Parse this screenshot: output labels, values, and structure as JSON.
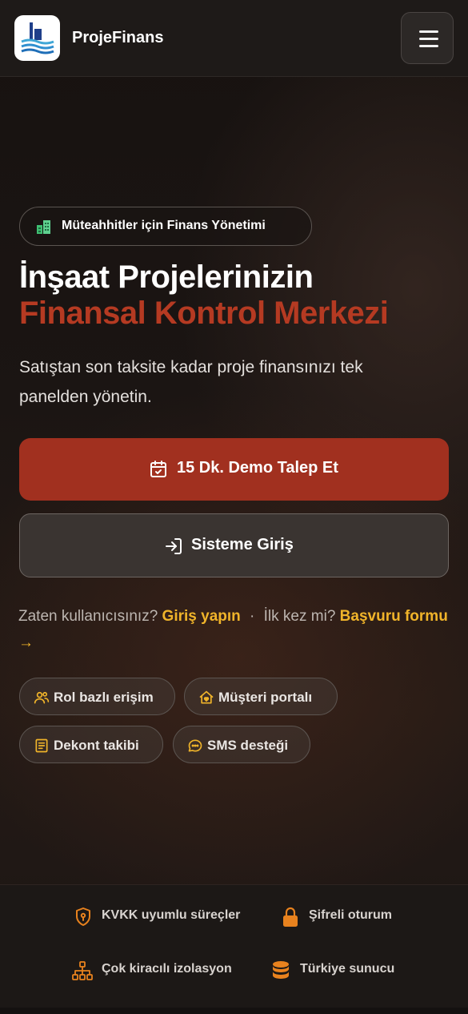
{
  "header": {
    "brand": "ProjeFinans",
    "menu_icon": "hamburger-menu-icon",
    "logo_icon": "building-logo-icon"
  },
  "hero": {
    "badge": "Müteahhitler için Finans Yönetimi",
    "badge_icon": "buildings-icon",
    "title_line1": "İnşaat Projelerinizin",
    "title_line2": "Finansal Kontrol Merkezi",
    "lead": "Satıştan son taksite kadar proje finansınızı tek panelden yönetin."
  },
  "actions": {
    "primary_label": "15 Dk. Demo Talep Et",
    "primary_icon": "calendar-check-icon",
    "secondary_label": "Sisteme Giriş",
    "secondary_icon": "login-icon"
  },
  "helper": {
    "existing_text": "Zaten kullanıcısınız?",
    "login_link": "Giriş yapın",
    "separator": "·",
    "first_time_text": "İlk kez mi?",
    "apply_link": "Başvuru formu →"
  },
  "chips": [
    {
      "label": "Rol bazlı erişim",
      "icon": "users-icon"
    },
    {
      "label": "Müşteri portalı",
      "icon": "home-heart-icon"
    },
    {
      "label": "Dekont takibi",
      "icon": "receipt-icon"
    },
    {
      "label": "SMS desteği",
      "icon": "chat-bubble-icon"
    }
  ],
  "footer_features": [
    {
      "label": "KVKK uyumlu süreçler",
      "icon": "shield-key-icon"
    },
    {
      "label": "Şifreli oturum",
      "icon": "lock-icon"
    },
    {
      "label": "Çok kiracılı izolasyon",
      "icon": "network-icon"
    },
    {
      "label": "Türkiye sunucu",
      "icon": "database-icon"
    }
  ],
  "colors": {
    "accent_red": "#a1301f",
    "title_red": "#b53a22",
    "link_yellow": "#f0b42a",
    "icon_orange": "#e8821e",
    "badge_green": "#3fbf72"
  }
}
